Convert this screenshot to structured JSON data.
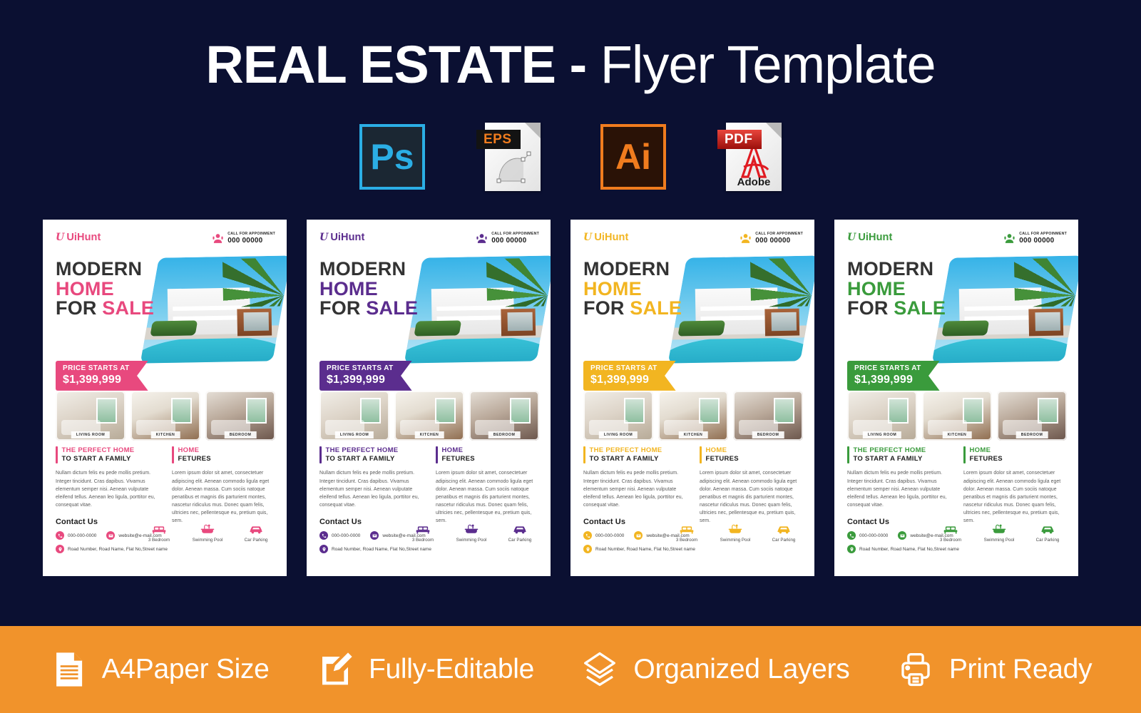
{
  "page": {
    "background_color": "#0B1032",
    "title_line": "REAL ESTATE - Flyer Template",
    "title_bold": "REAL ESTATE -",
    "title_light": "Flyer Template"
  },
  "formats": [
    {
      "id": "photoshop",
      "label": "Ps",
      "icon": "photoshop-icon",
      "accent": "#2BAEE5"
    },
    {
      "id": "eps",
      "label": "EPS",
      "icon": "eps-file-icon",
      "accent": "#F07C1E"
    },
    {
      "id": "illustrator",
      "label": "Ai",
      "icon": "illustrator-icon",
      "accent": "#F07C1E"
    },
    {
      "id": "pdf",
      "label": "PDF",
      "sublabel": "Adobe",
      "icon": "pdf-file-icon",
      "accent": "#C3161C"
    }
  ],
  "flyer_common": {
    "logo_mark": "U",
    "logo_text": "UiHunt",
    "appointment_label": "CALL FOR APPOINMENT",
    "appointment_phone": "000 00000",
    "headline_line1": "MODERN",
    "headline_line2": "HOME",
    "headline_line3_a": "FOR ",
    "headline_line3_b": "SALE",
    "price_label": "PRICE STARTS AT",
    "price_value": "$1,399,999",
    "thumbnails": [
      {
        "caption": "LIVING ROOM",
        "name": "living-room"
      },
      {
        "caption": "KITCHEN",
        "name": "kitchen"
      },
      {
        "caption": "BEDROOM",
        "name": "bedroom"
      }
    ],
    "section_left": {
      "heading1": "THE PERFECT HOME",
      "heading2": "TO START A FAMILY",
      "body": "Nullam dictum felis eu pede mollis pretium. Integer tincidunt. Cras dapibus. Vivamus elementum semper nisi. Aenean vulputate eleifend tellus. Aenean leo ligula, porttitor eu, consequat vitae."
    },
    "section_right": {
      "heading1": "HOME",
      "heading2": "FETURES",
      "body": "Lorem ipsum dolor sit amet, consectetuer adipiscing elit. Aenean commodo ligula eget dolor. Aenean massa. Cum sociis natoque penatibus et magnis dis parturient montes, nascetur ridiculus mus. Donec quam felis, ultricies nec, pellentesque eu, pretium quis, sem."
    },
    "contact": {
      "title": "Contact Us",
      "phone": "000-000-0000",
      "email": "website@e-mail.com",
      "address": "Road Number, Road Name, Flat No,Street name"
    },
    "features": [
      {
        "label": "3 Bedroom",
        "icon": "bed-icon"
      },
      {
        "label": "Swimming Pool",
        "icon": "bathtub-icon"
      },
      {
        "label": "Car Parking",
        "icon": "car-icon"
      }
    ]
  },
  "flyers": [
    {
      "variant": "pink",
      "accent": "#E8497E"
    },
    {
      "variant": "purple",
      "accent": "#5B2D8E"
    },
    {
      "variant": "yellow",
      "accent": "#F2B521"
    },
    {
      "variant": "green",
      "accent": "#3A9B3C"
    }
  ],
  "bottom_bar": {
    "background_color": "#F1932B",
    "items": [
      {
        "label": "A4Paper Size",
        "icon": "document-icon"
      },
      {
        "label": "Fully-Editable",
        "icon": "edit-pencil-icon"
      },
      {
        "label": "Organized Layers",
        "icon": "layers-icon"
      },
      {
        "label": "Print Ready",
        "icon": "printer-icon"
      }
    ]
  }
}
